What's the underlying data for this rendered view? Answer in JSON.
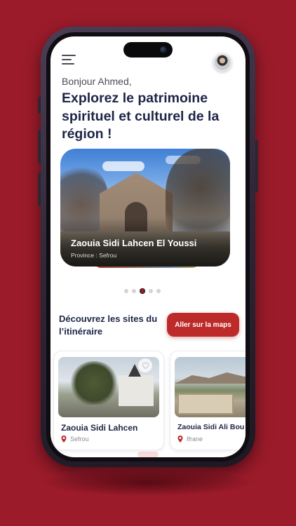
{
  "header": {
    "greeting": "Bonjour Ahmed,",
    "headline": "Explorez le patrimoine spirituel et culturel de la région !"
  },
  "hero": {
    "title": "Zaouia Sidi Lahcen El Youssi",
    "subtitle": "Province : Sefrou",
    "active_index": 2,
    "total": 5
  },
  "section": {
    "title": "Découvrez les sites du l’itinéraire",
    "button_label": "Aller sur la maps"
  },
  "sites": [
    {
      "name": "Zaouia Sidi Lahcen",
      "location": "Sefrou"
    },
    {
      "name": "Zaouia Sidi Ali Bou",
      "location": "Ifrane"
    }
  ],
  "colors": {
    "background": "#9b1b2a",
    "accent": "#bd2a2a",
    "heading": "#1d2547"
  },
  "icons": [
    "menu-icon",
    "avatar",
    "heart-icon",
    "location-pin-icon"
  ]
}
